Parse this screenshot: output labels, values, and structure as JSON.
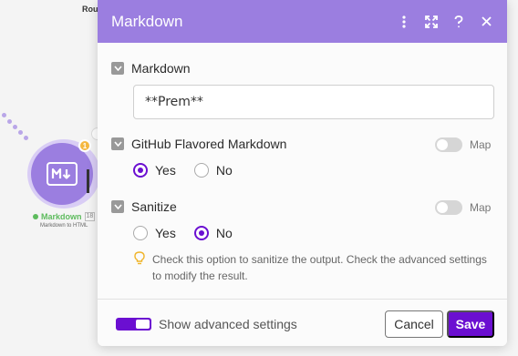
{
  "canvas": {
    "top_label": "Rout",
    "module": {
      "name": "Markdown",
      "id_badge": "18",
      "subtitle": "Markdown to HTML",
      "badge": "1"
    }
  },
  "panel": {
    "title": "Markdown",
    "header_icons": [
      "more-vertical-icon",
      "expand-icon",
      "help-icon",
      "close-icon"
    ],
    "fields": {
      "markdown": {
        "label": "Markdown",
        "value": "**Prem**"
      },
      "gfm": {
        "label": "GitHub Flavored Markdown",
        "map_label": "Map",
        "options": [
          "Yes",
          "No"
        ],
        "selected": "Yes"
      },
      "sanitize": {
        "label": "Sanitize",
        "map_label": "Map",
        "options": [
          "Yes",
          "No"
        ],
        "selected": "No",
        "hint": "Check this option to sanitize the output. Check the advanced settings to modify the result."
      }
    },
    "footer": {
      "advanced_label": "Show advanced settings",
      "cancel_label": "Cancel",
      "save_label": "Save"
    }
  },
  "colors": {
    "header": "#9b7ee0",
    "accent": "#6b0fd1",
    "status": "#5dbb5d"
  }
}
